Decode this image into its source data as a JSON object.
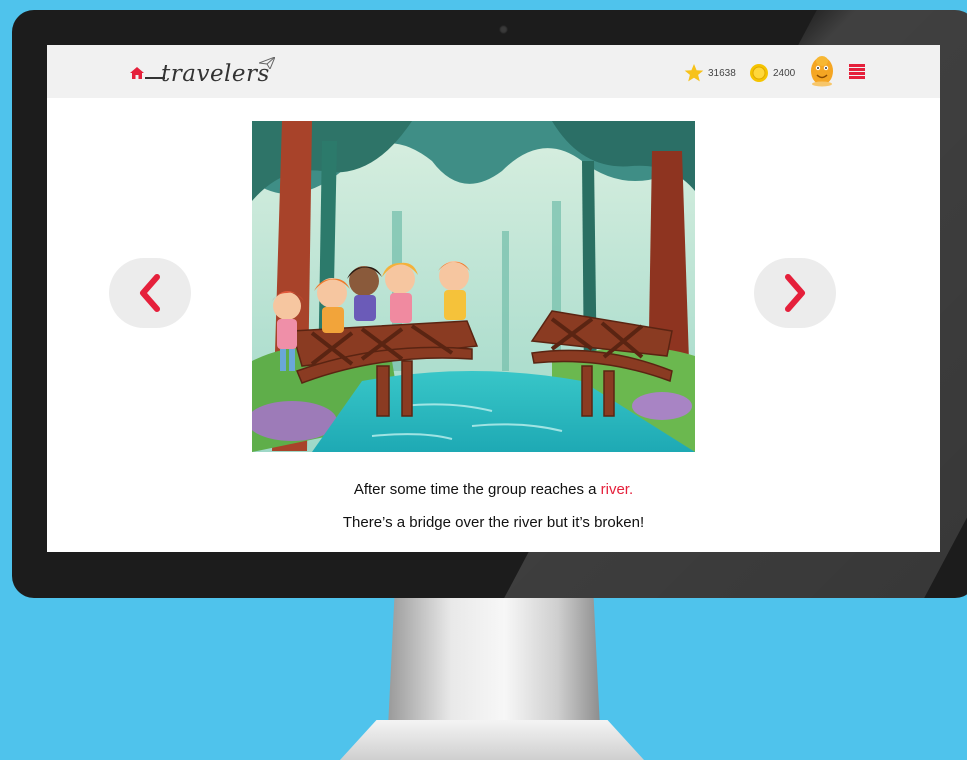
{
  "header": {
    "logo_text": "travelers",
    "stars_count": "31638",
    "coins_count": "2400"
  },
  "story": {
    "line1_prefix": "After some time the group reaches a ",
    "line1_highlight": "river.",
    "line2": "There’s a bridge over the river but it’s broken!"
  },
  "colors": {
    "accent": "#e5203b",
    "background": "#4fc3ec",
    "star": "#f7c21a",
    "coin": "#f5c400"
  },
  "icons": {
    "home": "home-icon",
    "star": "star-icon",
    "coin": "coin-icon",
    "avatar": "avatar-icon",
    "menu": "menu-icon",
    "prev": "chevron-left-icon",
    "next": "chevron-right-icon"
  }
}
